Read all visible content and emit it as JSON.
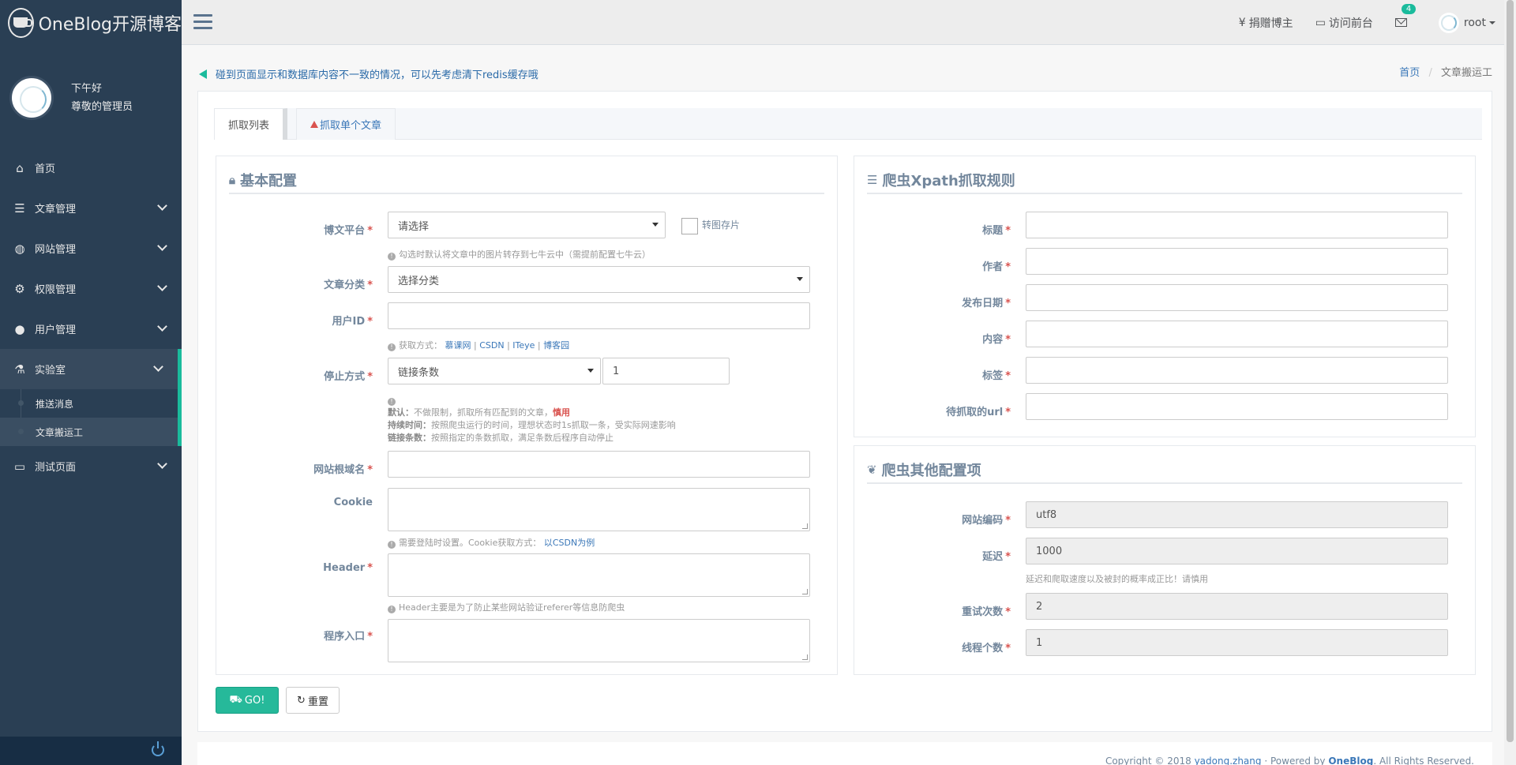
{
  "brand": {
    "title": "OneBlog开源博客"
  },
  "profile": {
    "greeting": "下午好",
    "name": "尊敬的管理员"
  },
  "sidebar": {
    "items": [
      {
        "label": "首页",
        "icon": "home-icon"
      },
      {
        "label": "文章管理",
        "icon": "list-icon"
      },
      {
        "label": "网站管理",
        "icon": "globe-icon"
      },
      {
        "label": "权限管理",
        "icon": "cogs-icon"
      },
      {
        "label": "用户管理",
        "icon": "users-icon"
      },
      {
        "label": "实验室",
        "icon": "flask-icon"
      },
      {
        "label": "测试页面",
        "icon": "desktop-icon"
      }
    ],
    "lab_sub": [
      {
        "label": "推送消息"
      },
      {
        "label": "文章搬运工"
      }
    ]
  },
  "topnav": {
    "donate": "捐赠博主",
    "frontend": "访问前台",
    "mail_badge": "4",
    "user": "root"
  },
  "notice": "碰到页面显示和数据库内容不一致的情况，可以先考虑清下redis缓存哦",
  "breadcrumb": {
    "home": "首页",
    "current": "文章搬运工"
  },
  "tabs": [
    {
      "label": "抓取列表"
    },
    {
      "label": "抓取单个文章"
    }
  ],
  "basic": {
    "title": "基本配置",
    "platform_label": "博文平台",
    "platform_value": "请选择",
    "convert_label": "转图存片",
    "platform_help": "勾选时默认将文章中的图片转存到七牛云中（需提前配置七牛云）",
    "category_label": "文章分类",
    "category_value": "选择分类",
    "userid_label": "用户ID",
    "userid_help_prefix": "获取方式：",
    "userid_help_links": [
      "慕课网",
      "CSDN",
      "ITeye",
      "博客园"
    ],
    "stop_label": "停止方式",
    "stop_value": "链接条数",
    "stop_count": "1",
    "stop_help_default_b": "默认：",
    "stop_help_default": "不做限制，抓取所有匹配到的文章，",
    "stop_help_default_warn": "慎用",
    "stop_help_time_b": "持续时间：",
    "stop_help_time": "按照爬虫运行的时间，理想状态时1s抓取一条，受实际网速影响",
    "stop_help_count_b": "链接条数：",
    "stop_help_count": "按照指定的条数抓取，满足条数后程序自动停止",
    "domain_label": "网站根域名",
    "cookie_label": "Cookie",
    "cookie_help": "需要登陆时设置。Cookie获取方式：",
    "cookie_help_link": "以CSDN为例",
    "header_label": "Header",
    "header_help": "Header主要是为了防止某些网站验证referer等信息防爬虫",
    "entry_label": "程序入口"
  },
  "xpath": {
    "title": "爬虫Xpath抓取规则",
    "fields": [
      {
        "label": "标题"
      },
      {
        "label": "作者"
      },
      {
        "label": "发布日期"
      },
      {
        "label": "内容"
      },
      {
        "label": "标签"
      },
      {
        "label": "待抓取的url"
      }
    ]
  },
  "other": {
    "title": "爬虫其他配置项",
    "encoding_label": "网站编码",
    "encoding_value": "utf8",
    "delay_label": "延迟",
    "delay_value": "1000",
    "delay_help": "延迟和爬取速度以及被封的概率成正比！请慎用",
    "retry_label": "重试次数",
    "retry_value": "2",
    "threads_label": "线程个数",
    "threads_value": "1"
  },
  "buttons": {
    "go": "GO!",
    "reset": "重置"
  },
  "footer": {
    "copyright": "Copyright © 2018",
    "author": "yadong.zhang",
    "powered": "· Powered by",
    "brand": "OneBlog",
    "rights": ". All Rights Reserved."
  },
  "colors": {
    "sidebar": "#2a3f54",
    "accent": "#1abb9c",
    "danger": "#d9534f",
    "link": "#3a77b8"
  }
}
